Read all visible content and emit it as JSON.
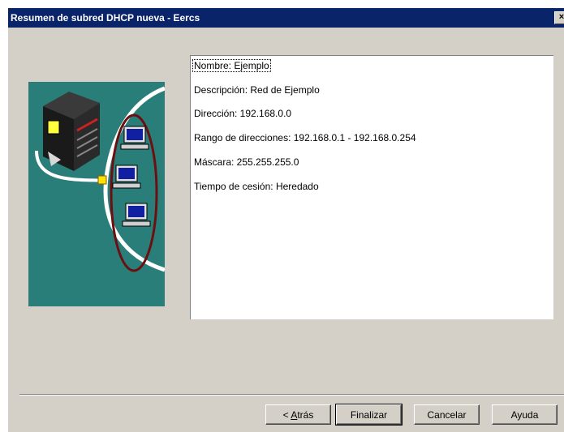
{
  "window": {
    "title": "Resumen de subred DHCP nueva - Eercs",
    "close_label": "×"
  },
  "summary": {
    "lines": [
      "Nombre:  Ejemplo",
      "Descripción:  Red de Ejemplo",
      "Dirección:  192.168.0.0",
      "Rango de direcciones:  192.168.0.1 - 192.168.0.254",
      "Máscara:  255.255.255.0",
      "Tiempo de cesión:  Heredado"
    ]
  },
  "buttons": {
    "back_prefix": "< ",
    "back_accel": "A",
    "back_rest": "trás",
    "finish": "Finalizar",
    "cancel": "Cancelar",
    "help": "Ayuda"
  },
  "colors": {
    "titlebar": "#0a246a",
    "illustration_bg": "#2a7e7a",
    "dialog_bg": "#d4d0c8"
  }
}
